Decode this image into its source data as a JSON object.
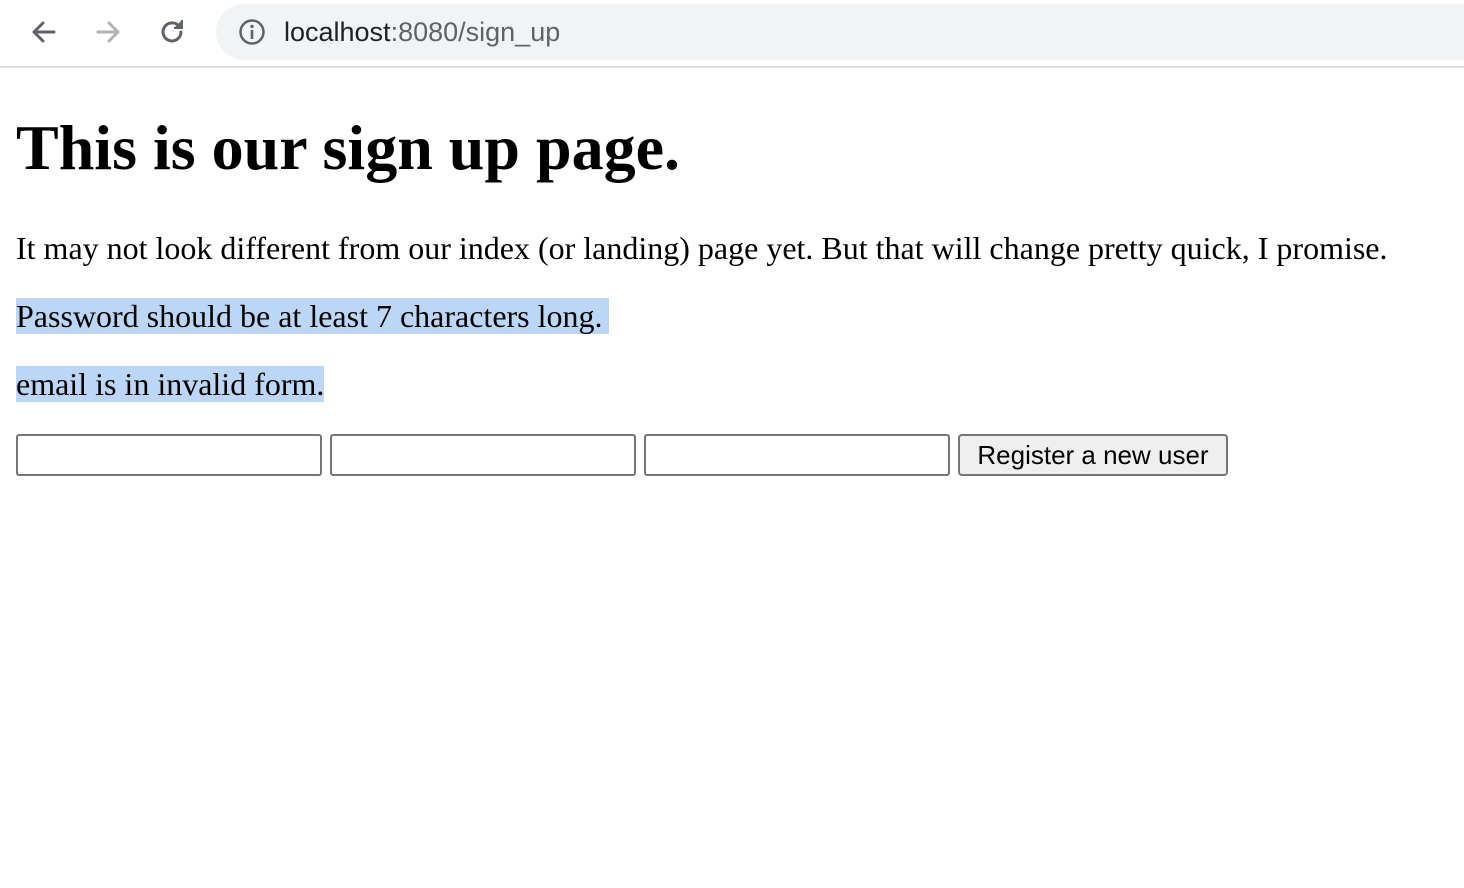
{
  "browser": {
    "url_host": "localhost",
    "url_rest": ":8080/sign_up",
    "icons": {
      "back": "arrow-left-icon",
      "forward": "arrow-right-icon",
      "reload": "reload-icon",
      "site_info": "info-icon"
    }
  },
  "page": {
    "heading": "This is our sign up page.",
    "intro": "It may not look different from our index (or landing) page yet. But that will change pretty quick, I promise.",
    "errors": [
      "Password should be at least 7 characters long.",
      "email is in invalid form."
    ],
    "form": {
      "fields": [
        {
          "value": ""
        },
        {
          "value": ""
        },
        {
          "value": ""
        }
      ],
      "submit_label": "Register a new user"
    }
  },
  "colors": {
    "selection_highlight": "#bcd6f6",
    "omnibox_bg": "#f1f3f4",
    "toolbar_border": "#dadce0"
  }
}
